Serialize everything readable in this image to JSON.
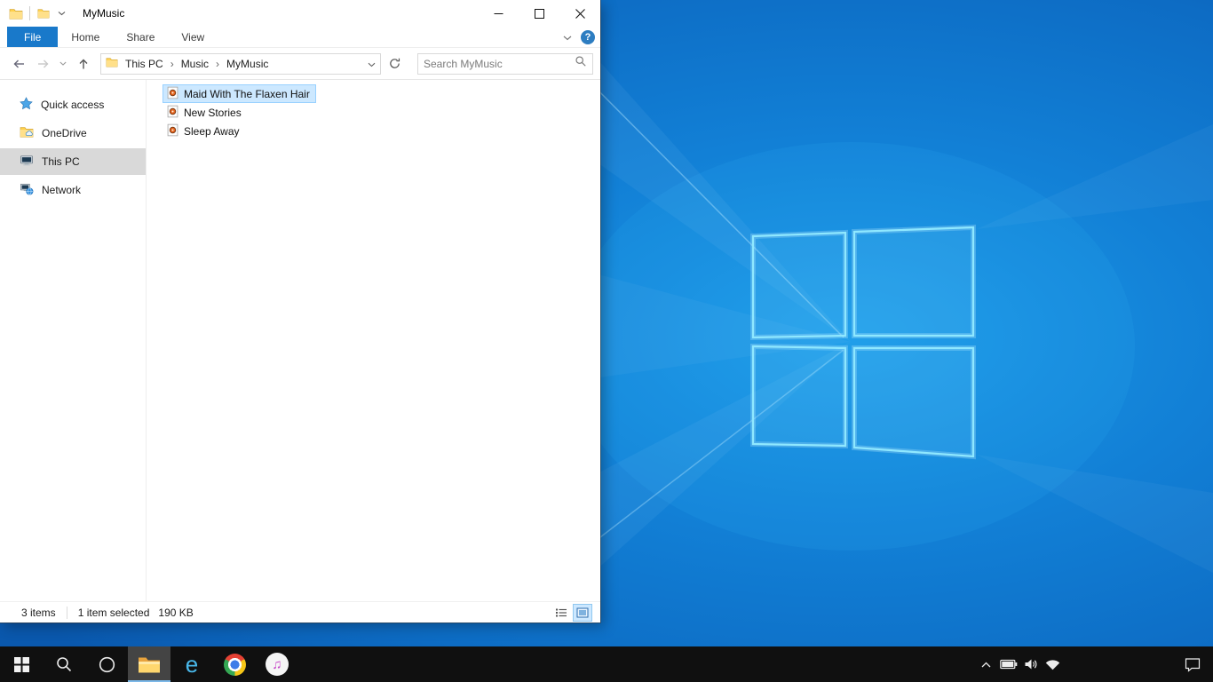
{
  "explorer": {
    "titlebar": {
      "title": "MyMusic"
    },
    "tabs": {
      "file": "File",
      "home": "Home",
      "share": "Share",
      "view": "View",
      "help_label": "?"
    },
    "nav": {
      "breadcrumb": {
        "root": "This PC",
        "parent": "Music",
        "current": "MyMusic",
        "separator": "›"
      },
      "search_placeholder": "Search MyMusic"
    },
    "sidebar": {
      "items": [
        {
          "label": "Quick access"
        },
        {
          "label": "OneDrive"
        },
        {
          "label": "This PC",
          "selected": true
        },
        {
          "label": "Network"
        }
      ]
    },
    "files": [
      {
        "name": "Maid With The Flaxen Hair",
        "selected": true
      },
      {
        "name": "New Stories",
        "selected": false
      },
      {
        "name": "Sleep Away",
        "selected": false
      }
    ],
    "statusbar": {
      "items_count": "3 items",
      "selected_count": "1 item selected",
      "selected_size": "190 KB"
    }
  },
  "taskbar": {
    "buttons": [
      "start",
      "search",
      "cortana",
      "file-explorer",
      "internet-explorer",
      "chrome",
      "itunes"
    ],
    "tray_icons": [
      "chevron-up",
      "battery",
      "volume",
      "wifi"
    ],
    "action_center": "action-center",
    "ie_glyph": "e",
    "itunes_glyph": "♫"
  },
  "colors": {
    "accent_blue": "#1979ca",
    "selection_bg": "#cce8ff",
    "selection_border": "#99d1ff",
    "sidebar_selected": "#d9d9d9",
    "taskbar_bg": "#101010",
    "wallpaper_base": "#0d6cc4"
  }
}
